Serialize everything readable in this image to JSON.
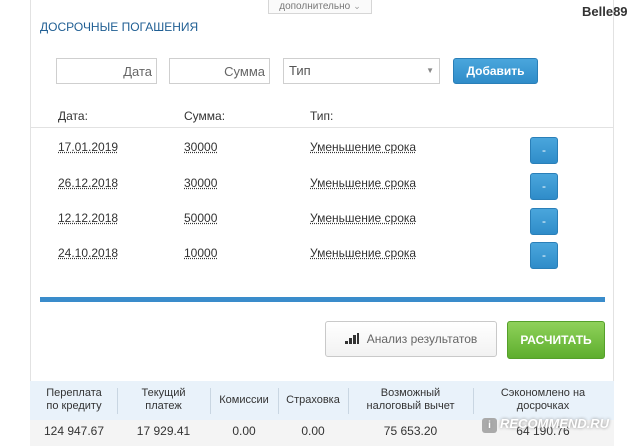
{
  "header": {
    "extra_tab": "дополнительно",
    "username": "Belle89",
    "section_title": "ДОСРОЧНЫЕ ПОГАШЕНИЯ"
  },
  "form": {
    "date_placeholder": "Дата",
    "sum_placeholder": "Сумма",
    "type_value": "Тип",
    "add_label": "Добавить"
  },
  "columns": {
    "date": "Дата:",
    "sum": "Сумма:",
    "type": "Тип:"
  },
  "rows": [
    {
      "date": "17.01.2019",
      "sum": "30000",
      "type": "Уменьшение срока",
      "remove": "-"
    },
    {
      "date": "26.12.2018",
      "sum": "30000",
      "type": "Уменьшение срока",
      "remove": "-"
    },
    {
      "date": "12.12.2018",
      "sum": "50000",
      "type": "Уменьшение срока",
      "remove": "-"
    },
    {
      "date": "24.10.2018",
      "sum": "10000",
      "type": "Уменьшение срока",
      "remove": "-"
    }
  ],
  "actions": {
    "analyze_label": "Анализ результатов",
    "calc_label": "РАСЧИТАТЬ"
  },
  "summary": {
    "headers": [
      [
        "Переплата",
        "по кредиту"
      ],
      [
        "Текущий",
        "платеж"
      ],
      [
        "Комиссии",
        ""
      ],
      [
        "Страховка",
        ""
      ],
      [
        "Возможный",
        "налоговый вычет"
      ],
      [
        "Сэкономлено на",
        "досрочках"
      ]
    ],
    "values": [
      "124 947.67",
      "17 929.41",
      "0.00",
      "0.00",
      "75 653.20",
      "64 190.76"
    ]
  },
  "watermark": {
    "text": "RECOMMEND.RU",
    "icon_letter": "i"
  },
  "colors": {
    "accent_blue": "#3a8ccb",
    "calc_green": "#5eae2e",
    "title_blue": "#1f5e93"
  }
}
